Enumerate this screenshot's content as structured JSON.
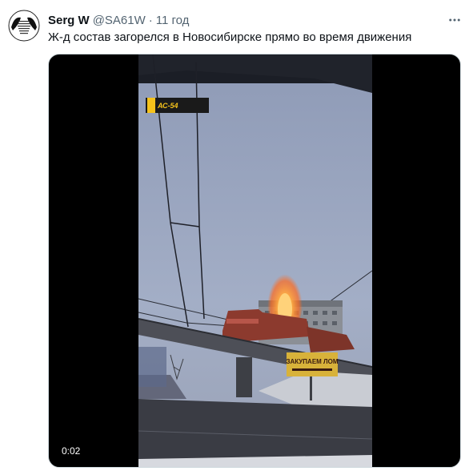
{
  "author": {
    "name": "Serg W",
    "handle": "@SA61W",
    "separator": "·",
    "time": "11 год",
    "avatar_icon": "avatar-icon"
  },
  "tweet": {
    "text": "Ж-д состав загорелся в Новосибирске прямо во время движения"
  },
  "video": {
    "duration": "0:02",
    "watermark": "АС-54",
    "sign_text": "ЗАКУПАЕМ ЛОМ"
  },
  "icons": {
    "more": "more-options-icon"
  },
  "colors": {
    "name": "#0f1419",
    "secondary": "#536471",
    "accent_badge": "#f5c21b",
    "fire": "#ff8a1f"
  }
}
